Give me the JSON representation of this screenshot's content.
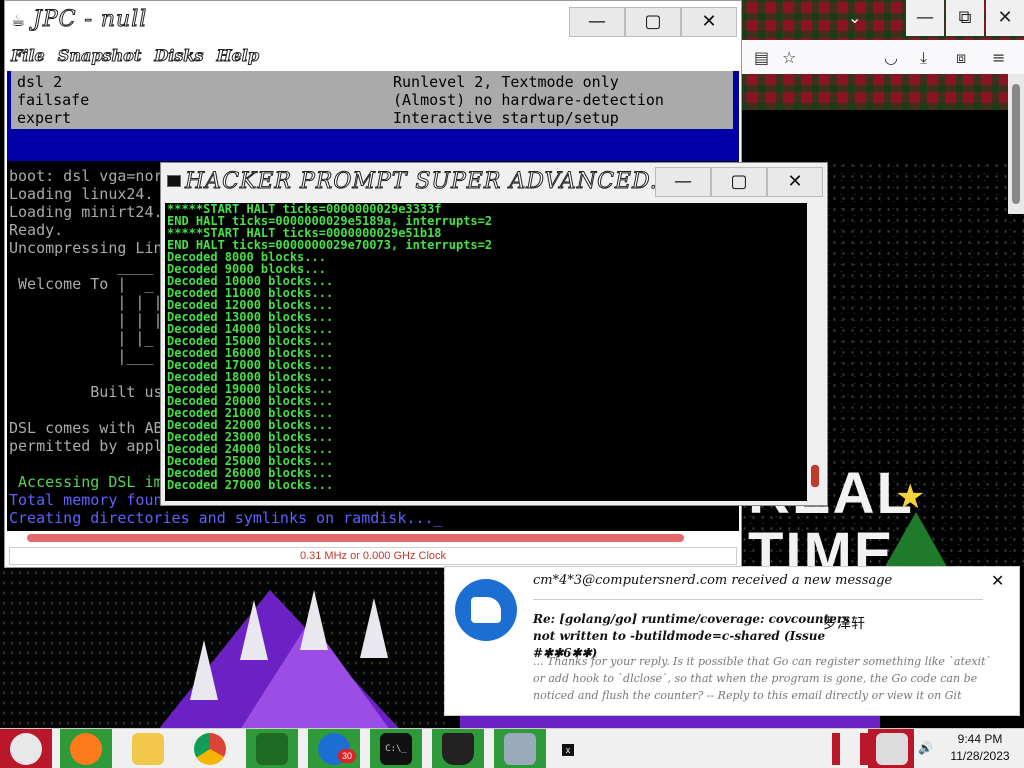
{
  "jpc": {
    "title": "JPC - null",
    "controls": {
      "minimize": "—",
      "maximize": "▢",
      "close": "✕"
    },
    "menu": [
      "File",
      "Snapshot",
      "Disks",
      "Help"
    ],
    "boot_menu": [
      {
        "name": "dsl 2",
        "desc": "Runlevel 2, Textmode only"
      },
      {
        "name": "failsafe",
        "desc": "(Almost) no hardware-detection"
      },
      {
        "name": "expert",
        "desc": "Interactive startup/setup"
      }
    ],
    "console": [
      {
        "text": "boot: dsl vga=nor",
        "color": "gray"
      },
      {
        "text": "Loading linux24.",
        "color": "gray"
      },
      {
        "text": "Loading minirt24.",
        "color": "gray"
      },
      {
        "text": "Ready.",
        "color": "gray"
      },
      {
        "text": "Uncompressing Lin",
        "color": "gray"
      },
      {
        "text": "            ____",
        "color": "gray"
      },
      {
        "text": " Welcome To |  _",
        "color": "gray"
      },
      {
        "text": "            | | |",
        "color": "gray"
      },
      {
        "text": "            | | |",
        "color": "gray"
      },
      {
        "text": "            | |_",
        "color": "gray"
      },
      {
        "text": "            |___",
        "color": "gray"
      },
      {
        "text": "",
        "color": "gray"
      },
      {
        "text": "         Built usi",
        "color": "gray"
      },
      {
        "text": "",
        "color": "gray"
      },
      {
        "text": "DSL comes with AB",
        "color": "gray"
      },
      {
        "text": "permitted by appl",
        "color": "gray"
      },
      {
        "text": "",
        "color": "gray"
      },
      {
        "text": " Accessing DSL im",
        "color": "green"
      },
      {
        "text": "Total memory foun",
        "color": "blue"
      },
      {
        "text": "Creating directories and symlinks on ramdisk..._",
        "color": "blue"
      }
    ],
    "progress": 0.95,
    "clock_status": "0.31 MHz or 0.000 GHz Clock"
  },
  "hacker": {
    "title": "HACKER PROMPT SUPER ADVANCED...",
    "lines": [
      "*****START HALT ticks=0000000029e3333f",
      "END HALT ticks=0000000029e5189a, interrupts=2",
      "*****START HALT ticks=0000000029e51b18",
      "END HALT ticks=0000000029e70073, interrupts=2",
      "Decoded 8000 blocks...",
      "Decoded 9000 blocks...",
      "Decoded 10000 blocks...",
      "Decoded 11000 blocks...",
      "Decoded 12000 blocks...",
      "Decoded 13000 blocks...",
      "Decoded 14000 blocks...",
      "Decoded 15000 blocks...",
      "Decoded 16000 blocks...",
      "Decoded 17000 blocks...",
      "Decoded 18000 blocks...",
      "Decoded 19000 blocks...",
      "Decoded 20000 blocks...",
      "Decoded 21000 blocks...",
      "Decoded 22000 blocks...",
      "Decoded 23000 blocks...",
      "Decoded 24000 blocks...",
      "Decoded 25000 blocks...",
      "Decoded 26000 blocks...",
      "Decoded 27000 blocks..."
    ]
  },
  "desktop": {
    "real_time_line1": "REAL",
    "real_time_line2": "TIME"
  },
  "browser": {
    "controls": {
      "minimize": "—",
      "maximize": "⧉",
      "close": "✕"
    },
    "chevron": "⌄"
  },
  "notification": {
    "from": "cm*4*3@computersnerd.com received a new message",
    "subject": "Re: [golang/go] runtime/coverage: covcounters not written to -butildmode=c-shared (Issue #✱✱6✱✱)",
    "chinese_name": "罗泽轩",
    "body": "... Thanks for your reply. Is it possible that Go can register something like `atexit` or add hook to `dlclose`, so that when the program is gone, the Go code can be noticed and flush the counter? -- Reply to this email directly or view it on Git",
    "close": "✕"
  },
  "taskbar": {
    "time": "9:44 PM",
    "date": "11/28/2023",
    "mail_badge": "30",
    "terminal_glyph": "C:\\_",
    "tray_close": "x",
    "items": [
      "santa-icon",
      "firefox-icon",
      "file-explorer-icon",
      "chrome-icon",
      "christmas-tree-icon",
      "thunderbird-icon",
      "command-prompt-icon",
      "magic-hat-icon",
      "computer-icon"
    ]
  }
}
